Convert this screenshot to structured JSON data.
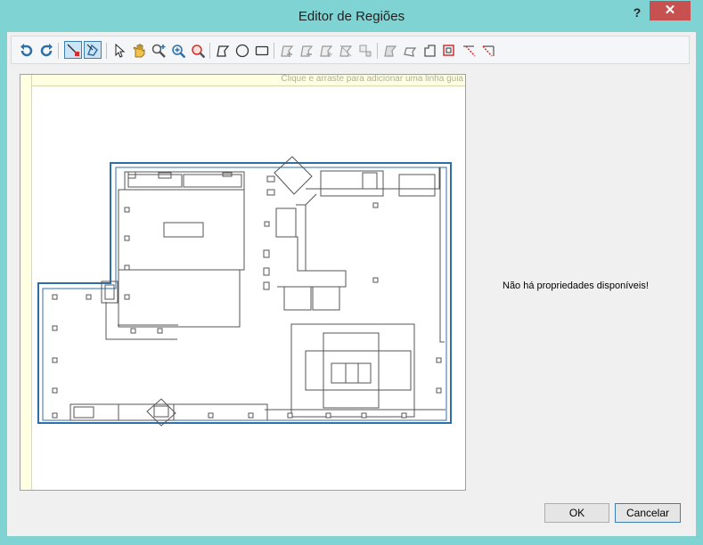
{
  "window": {
    "title": "Editor de Regiões",
    "help_label": "?",
    "close_label": "✕"
  },
  "toolbar": {
    "tools": [
      "undo-icon",
      "redo-icon",
      "edit-region-icon",
      "edit-region-alt-icon",
      "pointer-icon",
      "pan-icon",
      "zoom-in-icon",
      "zoom-extent-icon",
      "zoom-window-icon",
      "polygon-icon",
      "circle-icon",
      "rectangle-icon",
      "add-vertex-icon",
      "remove-vertex-icon",
      "move-vertex-icon",
      "split-icon",
      "align-icon",
      "merge-icon",
      "union-icon",
      "subtract-icon",
      "intersect-icon",
      "delete-region-icon",
      "delete-all-icon"
    ]
  },
  "canvas": {
    "guide_hint": "Clique e arraste para adicionar uma linha guia"
  },
  "properties": {
    "empty_message": "Não há propriedades disponíveis!"
  },
  "footer": {
    "ok_label": "OK",
    "cancel_label": "Cancelar"
  },
  "colors": {
    "frame": "#7fd3d3",
    "close": "#c75050",
    "outline": "#2f6fa8",
    "plan": "#555555"
  }
}
